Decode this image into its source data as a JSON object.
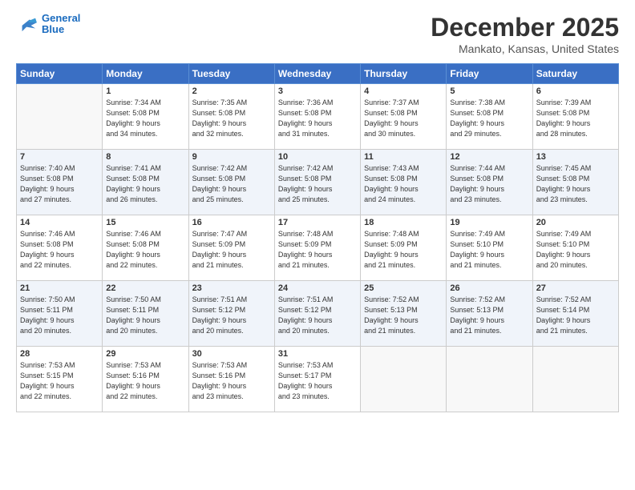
{
  "header": {
    "logo_line1": "General",
    "logo_line2": "Blue",
    "month": "December 2025",
    "location": "Mankato, Kansas, United States"
  },
  "days_of_week": [
    "Sunday",
    "Monday",
    "Tuesday",
    "Wednesday",
    "Thursday",
    "Friday",
    "Saturday"
  ],
  "weeks": [
    [
      {
        "num": "",
        "info": ""
      },
      {
        "num": "1",
        "info": "Sunrise: 7:34 AM\nSunset: 5:08 PM\nDaylight: 9 hours\nand 34 minutes."
      },
      {
        "num": "2",
        "info": "Sunrise: 7:35 AM\nSunset: 5:08 PM\nDaylight: 9 hours\nand 32 minutes."
      },
      {
        "num": "3",
        "info": "Sunrise: 7:36 AM\nSunset: 5:08 PM\nDaylight: 9 hours\nand 31 minutes."
      },
      {
        "num": "4",
        "info": "Sunrise: 7:37 AM\nSunset: 5:08 PM\nDaylight: 9 hours\nand 30 minutes."
      },
      {
        "num": "5",
        "info": "Sunrise: 7:38 AM\nSunset: 5:08 PM\nDaylight: 9 hours\nand 29 minutes."
      },
      {
        "num": "6",
        "info": "Sunrise: 7:39 AM\nSunset: 5:08 PM\nDaylight: 9 hours\nand 28 minutes."
      }
    ],
    [
      {
        "num": "7",
        "info": "Sunrise: 7:40 AM\nSunset: 5:08 PM\nDaylight: 9 hours\nand 27 minutes."
      },
      {
        "num": "8",
        "info": "Sunrise: 7:41 AM\nSunset: 5:08 PM\nDaylight: 9 hours\nand 26 minutes."
      },
      {
        "num": "9",
        "info": "Sunrise: 7:42 AM\nSunset: 5:08 PM\nDaylight: 9 hours\nand 25 minutes."
      },
      {
        "num": "10",
        "info": "Sunrise: 7:42 AM\nSunset: 5:08 PM\nDaylight: 9 hours\nand 25 minutes."
      },
      {
        "num": "11",
        "info": "Sunrise: 7:43 AM\nSunset: 5:08 PM\nDaylight: 9 hours\nand 24 minutes."
      },
      {
        "num": "12",
        "info": "Sunrise: 7:44 AM\nSunset: 5:08 PM\nDaylight: 9 hours\nand 23 minutes."
      },
      {
        "num": "13",
        "info": "Sunrise: 7:45 AM\nSunset: 5:08 PM\nDaylight: 9 hours\nand 23 minutes."
      }
    ],
    [
      {
        "num": "14",
        "info": "Sunrise: 7:46 AM\nSunset: 5:08 PM\nDaylight: 9 hours\nand 22 minutes."
      },
      {
        "num": "15",
        "info": "Sunrise: 7:46 AM\nSunset: 5:08 PM\nDaylight: 9 hours\nand 22 minutes."
      },
      {
        "num": "16",
        "info": "Sunrise: 7:47 AM\nSunset: 5:09 PM\nDaylight: 9 hours\nand 21 minutes."
      },
      {
        "num": "17",
        "info": "Sunrise: 7:48 AM\nSunset: 5:09 PM\nDaylight: 9 hours\nand 21 minutes."
      },
      {
        "num": "18",
        "info": "Sunrise: 7:48 AM\nSunset: 5:09 PM\nDaylight: 9 hours\nand 21 minutes."
      },
      {
        "num": "19",
        "info": "Sunrise: 7:49 AM\nSunset: 5:10 PM\nDaylight: 9 hours\nand 21 minutes."
      },
      {
        "num": "20",
        "info": "Sunrise: 7:49 AM\nSunset: 5:10 PM\nDaylight: 9 hours\nand 20 minutes."
      }
    ],
    [
      {
        "num": "21",
        "info": "Sunrise: 7:50 AM\nSunset: 5:11 PM\nDaylight: 9 hours\nand 20 minutes."
      },
      {
        "num": "22",
        "info": "Sunrise: 7:50 AM\nSunset: 5:11 PM\nDaylight: 9 hours\nand 20 minutes."
      },
      {
        "num": "23",
        "info": "Sunrise: 7:51 AM\nSunset: 5:12 PM\nDaylight: 9 hours\nand 20 minutes."
      },
      {
        "num": "24",
        "info": "Sunrise: 7:51 AM\nSunset: 5:12 PM\nDaylight: 9 hours\nand 20 minutes."
      },
      {
        "num": "25",
        "info": "Sunrise: 7:52 AM\nSunset: 5:13 PM\nDaylight: 9 hours\nand 21 minutes."
      },
      {
        "num": "26",
        "info": "Sunrise: 7:52 AM\nSunset: 5:13 PM\nDaylight: 9 hours\nand 21 minutes."
      },
      {
        "num": "27",
        "info": "Sunrise: 7:52 AM\nSunset: 5:14 PM\nDaylight: 9 hours\nand 21 minutes."
      }
    ],
    [
      {
        "num": "28",
        "info": "Sunrise: 7:53 AM\nSunset: 5:15 PM\nDaylight: 9 hours\nand 22 minutes."
      },
      {
        "num": "29",
        "info": "Sunrise: 7:53 AM\nSunset: 5:16 PM\nDaylight: 9 hours\nand 22 minutes."
      },
      {
        "num": "30",
        "info": "Sunrise: 7:53 AM\nSunset: 5:16 PM\nDaylight: 9 hours\nand 23 minutes."
      },
      {
        "num": "31",
        "info": "Sunrise: 7:53 AM\nSunset: 5:17 PM\nDaylight: 9 hours\nand 23 minutes."
      },
      {
        "num": "",
        "info": ""
      },
      {
        "num": "",
        "info": ""
      },
      {
        "num": "",
        "info": ""
      }
    ]
  ]
}
